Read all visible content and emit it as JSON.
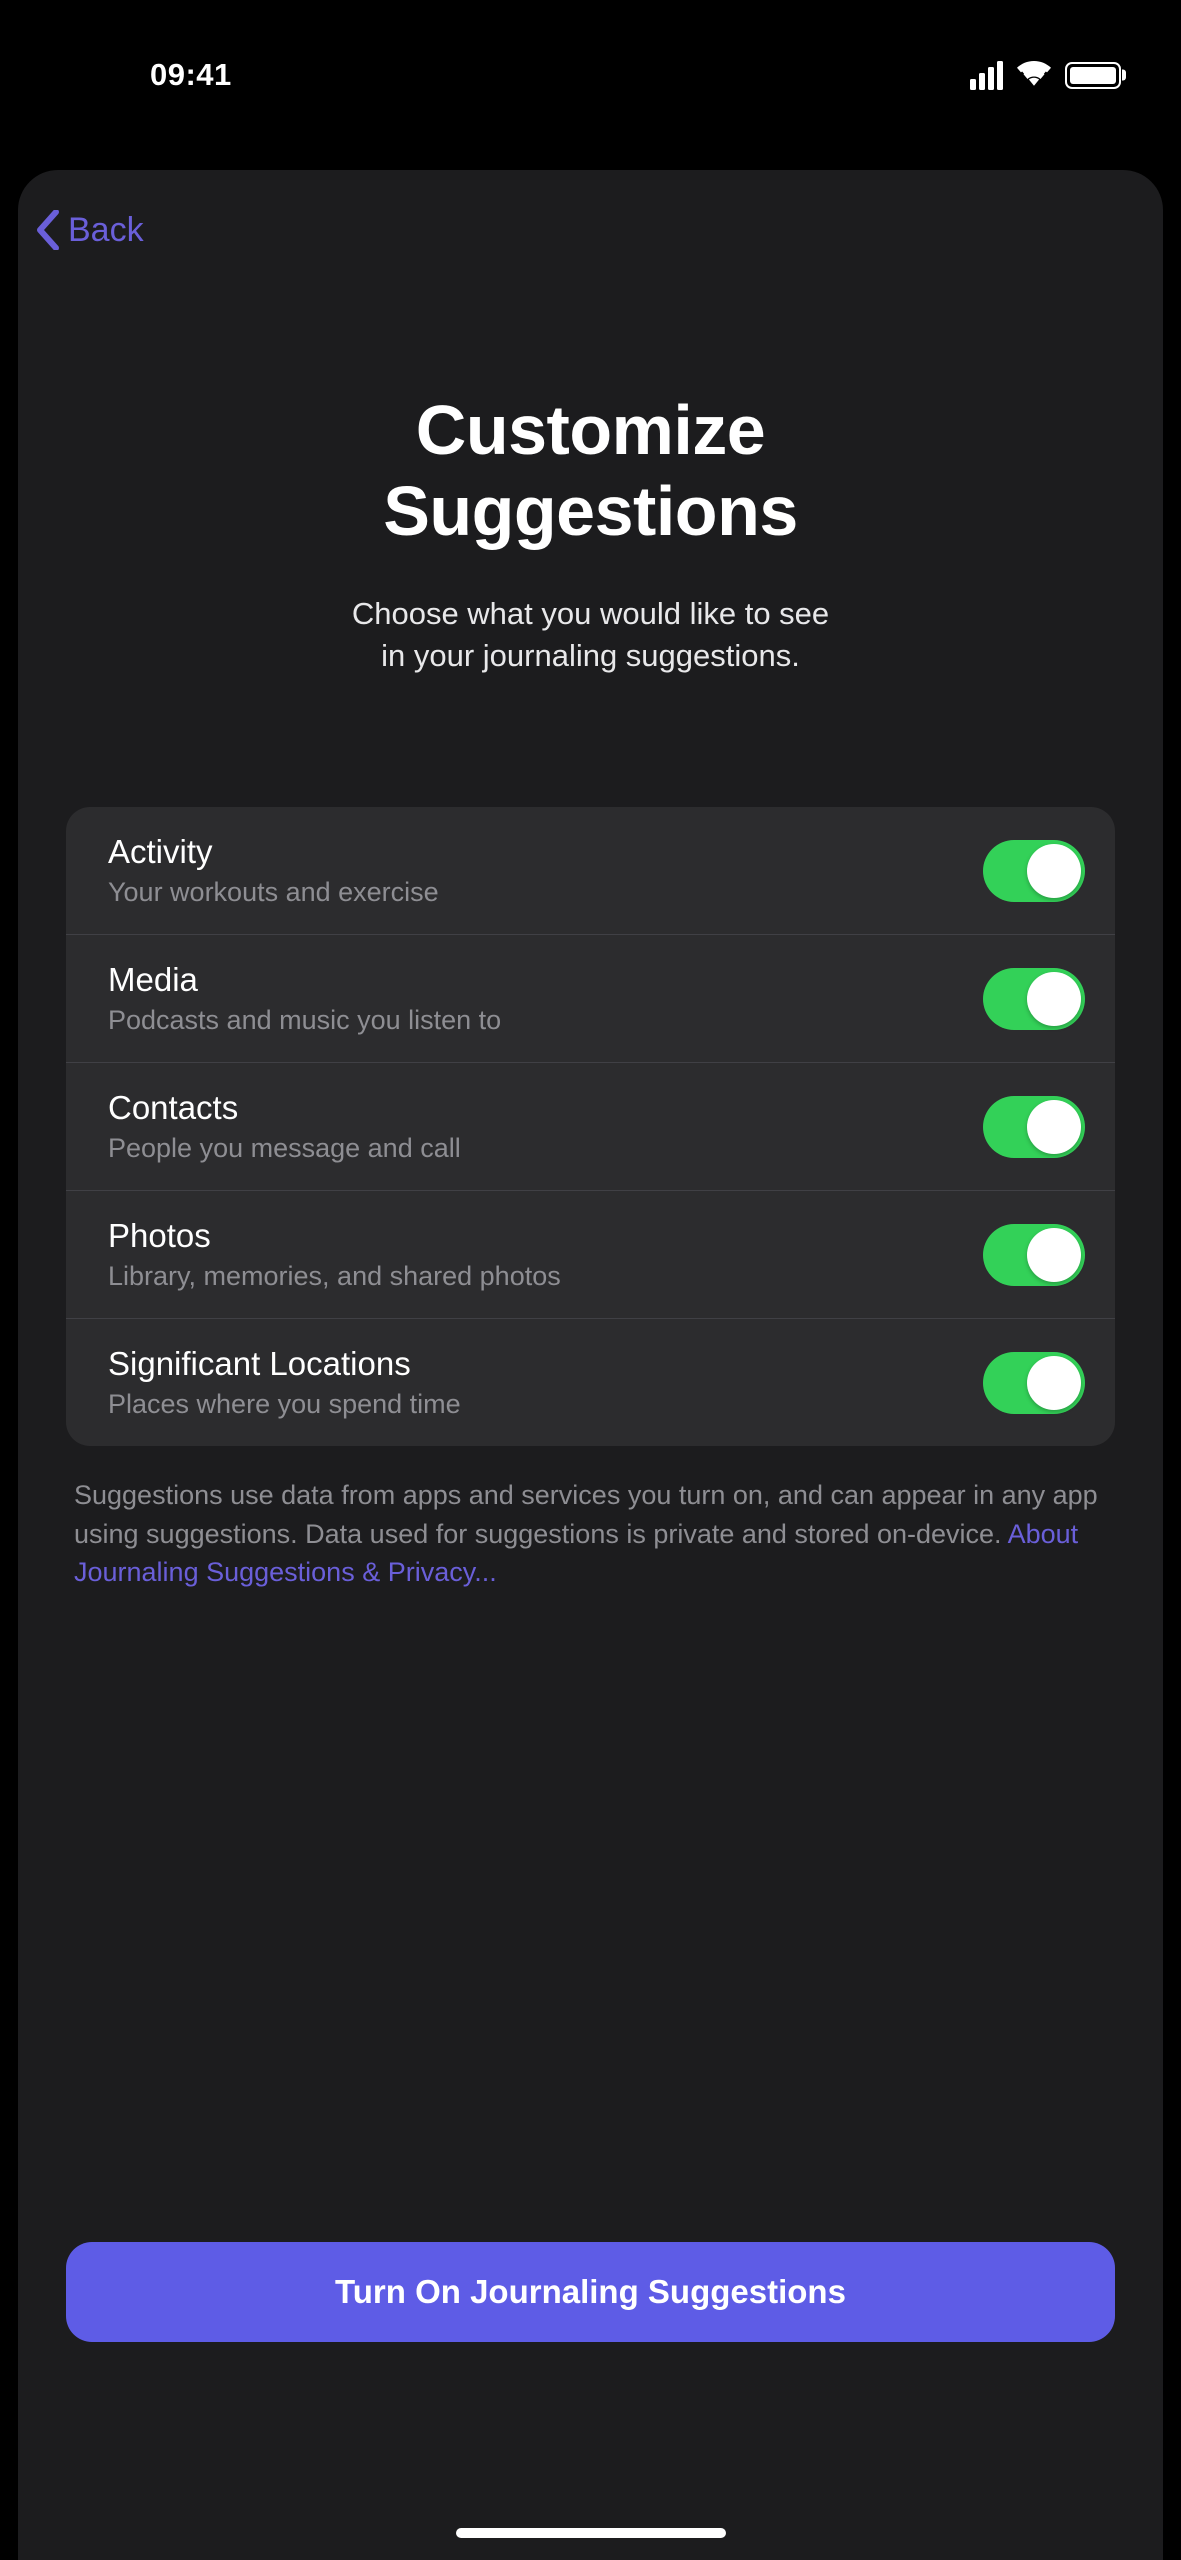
{
  "status": {
    "time": "09:41"
  },
  "nav": {
    "back_label": "Back"
  },
  "header": {
    "title_line1": "Customize",
    "title_line2": "Suggestions",
    "subtitle_line1": "Choose what you would like to see",
    "subtitle_line2": "in your journaling suggestions."
  },
  "settings": [
    {
      "title": "Activity",
      "desc": "Your workouts and exercise",
      "on": true
    },
    {
      "title": "Media",
      "desc": "Podcasts and music you listen to",
      "on": true
    },
    {
      "title": "Contacts",
      "desc": "People you message and call",
      "on": true
    },
    {
      "title": "Photos",
      "desc": "Library, memories, and shared photos",
      "on": true
    },
    {
      "title": "Significant Locations",
      "desc": "Places where you spend time",
      "on": true
    }
  ],
  "footer": {
    "text": "Suggestions use data from apps and services you turn on, and can appear in any app using suggestions. Data used for suggestions is private and stored on-device. ",
    "link": "About Journaling Suggestions & Privacy..."
  },
  "button": {
    "label": "Turn On Journaling Suggestions"
  }
}
